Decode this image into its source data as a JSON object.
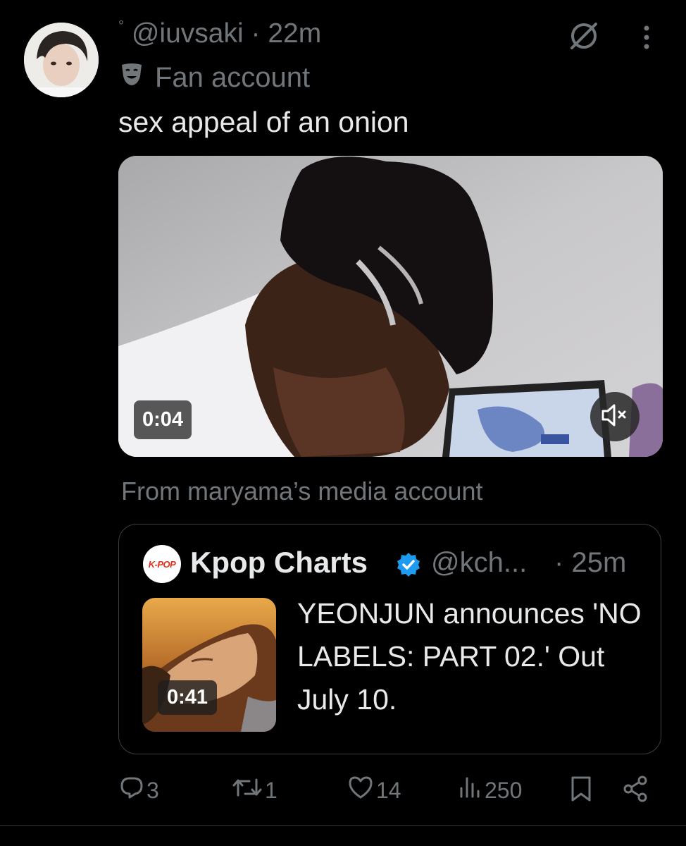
{
  "post": {
    "dot_marker": "°",
    "handle": "@iuvsaki",
    "separator": "·",
    "time": "22m",
    "badge_text": "Fan account",
    "text": "sex appeal of an onion",
    "media": {
      "duration": "0:04",
      "muted": true
    },
    "attribution": "From maryama’s media account"
  },
  "quote": {
    "logo_text": "K-POP",
    "name": "Kpop Charts",
    "verified": true,
    "handle": "@kch...",
    "separator": "·",
    "time": "25m",
    "thumb_duration": "0:41",
    "text": "YEONJUN announces 'NO LABELS: PART 02.' Out July 10."
  },
  "actions": {
    "replies": "3",
    "reposts": "1",
    "likes": "14",
    "views": "250"
  },
  "icons": [
    "grok-icon",
    "more-icon",
    "theater-mask-icon",
    "mute-icon",
    "verified-icon",
    "reply-icon",
    "repost-icon",
    "like-icon",
    "views-icon",
    "bookmark-icon",
    "share-icon"
  ],
  "colors": {
    "background": "#000000",
    "text": "#e7e9ea",
    "muted": "#71767b",
    "verified": "#1d9bf0",
    "border": "#2f3336"
  }
}
